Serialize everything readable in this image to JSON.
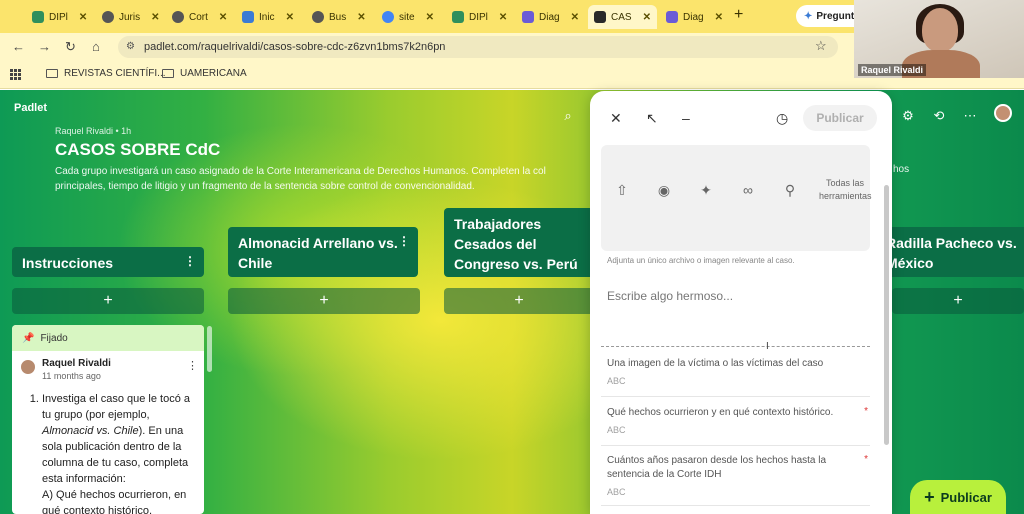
{
  "browser": {
    "tabs": [
      {
        "label": "DIPl",
        "icon_color": "#2f8f5c"
      },
      {
        "label": "Juris",
        "icon_color": "#555555"
      },
      {
        "label": "Cort",
        "icon_color": "#555555"
      },
      {
        "label": "Inic",
        "icon_color": "#3a7bd5"
      },
      {
        "label": "Bus",
        "icon_color": "#555555"
      },
      {
        "label": "site",
        "icon_color": "#4285f4"
      },
      {
        "label": "DIPl",
        "icon_color": "#2f8f5c"
      },
      {
        "label": "Diag",
        "icon_color": "#6b5bd6"
      },
      {
        "label": "CAS",
        "icon_color": "#2a2a2a"
      },
      {
        "label": "Diag",
        "icon_color": "#6b5bd6"
      }
    ],
    "tab_close": "✕",
    "new_tab": "+",
    "ask_label": "Pregunta",
    "url": "padlet.com/raquelrivaldi/casos-sobre-cdc-z6zvn1bms7k2n6pn",
    "bookmarks": [
      "REVISTAS CIENTÍFI...",
      "UAMERICANA"
    ]
  },
  "video": {
    "name": "Raquel Rivaldi"
  },
  "board": {
    "logo": "Padlet",
    "author": "Raquel Rivaldi • 1h",
    "title": "CASOS SOBRE CdC",
    "description": "Cada grupo investigará un caso asignado de la Corte Interamericana de Derechos Humanos. Completen la col principales, tiempo de litigio y un fragmento de la sentencia sobre control de convencionalidad.",
    "description_tail": "hos",
    "columns": [
      {
        "title": "Instrucciones"
      },
      {
        "title": "Almonacid Arrellano vs. Chile"
      },
      {
        "title": "Trabajadores Cesados del Congreso vs. Perú"
      },
      {
        "title": "Radilla Pacheco vs. México"
      }
    ],
    "add_icon": "+",
    "pinned_card": {
      "pin_label": "Fijado",
      "author": "Raquel Rivaldi",
      "time": "11 months ago",
      "text_1": "Investiga el caso que le tocó a tu grupo (por ejemplo, ",
      "text_italic": "Almonacid vs. Chile",
      "text_2": "). En una sola publicación dentro de la columna de tu caso, completa esta información:",
      "text_3": "A) Qué hechos ocurrieron, en qué contexto histórico,"
    },
    "publish_button": "Publicar"
  },
  "composer": {
    "publish_label": "Publicar",
    "attach_all_label": "Todas las herramientas",
    "attach_help": "Adjunta un único archivo o imagen relevante al caso.",
    "body_placeholder": "Escribe algo hermoso...",
    "fields": [
      {
        "label": "Una imagen de la víctima o las víctimas del caso",
        "placeholder": "ABC",
        "required": ""
      },
      {
        "label": "Qué hechos ocurrieron y en qué contexto histórico.",
        "placeholder": "ABC",
        "required": "*"
      },
      {
        "label": "Cuántos años pasaron desde los hechos hasta la sentencia de la Corte IDH",
        "placeholder": "ABC",
        "required": "*"
      }
    ]
  }
}
